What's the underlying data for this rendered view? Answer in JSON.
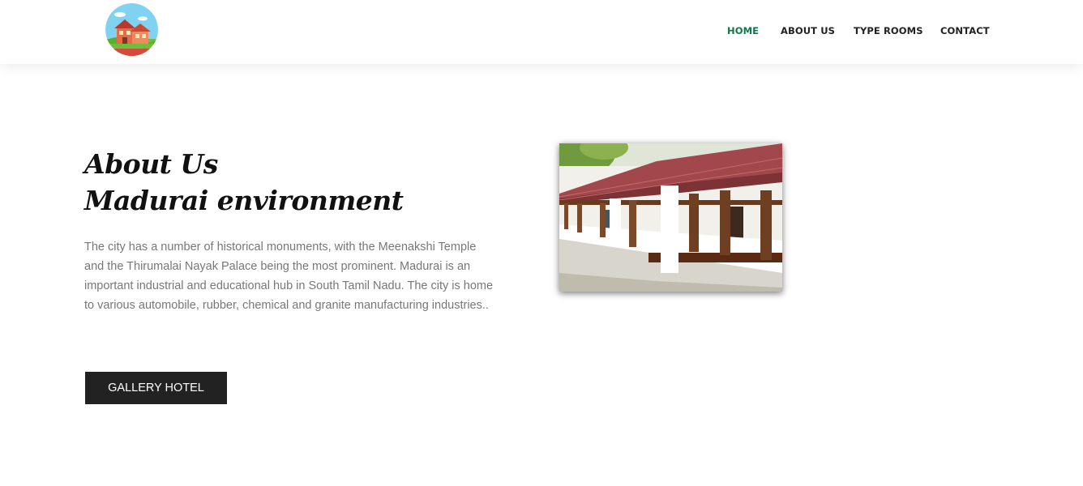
{
  "header": {
    "logo_icon": "house-landscape-logo",
    "nav": [
      {
        "label": "HOME",
        "active": true
      },
      {
        "label": "ABOUT US",
        "active": false
      },
      {
        "label": "TYPE ROOMS",
        "active": false
      },
      {
        "label": "CONTACT",
        "active": false
      }
    ],
    "active_color": "#0b7a4b"
  },
  "about": {
    "title_line1": "About Us",
    "title_line2": "Madurai environment",
    "body": "The city has a number of historical monuments, with the Meenakshi Temple and the Thirumalai Nayak Palace being the most prominent. Madurai is an important industrial and educational hub in South Tamil Nadu. The city is home to various automobile, rubber, chemical and granite manufacturing industries..",
    "button_label": "GALLERY HOTEL",
    "image_icon": "heritage-veranda-photo"
  }
}
